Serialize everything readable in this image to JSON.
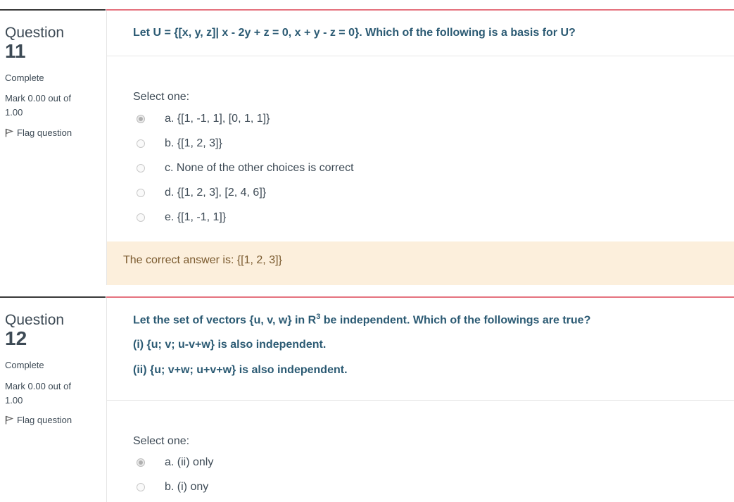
{
  "questions": [
    {
      "label": "Question",
      "number": "11",
      "state": "Complete",
      "mark_line1": "Mark 0.00 out of",
      "mark_line2": "1.00",
      "flag_label": "Flag question",
      "text": "Let U = {[x, y, z]| x - 2y + z = 0, x + y - z = 0}. Which of the following is a basis for U?",
      "prompt": "Select one:",
      "options": [
        {
          "label": "a. {[1, -1, 1], [0, 1, 1]}",
          "selected": true
        },
        {
          "label": "b. {[1, 2, 3]}",
          "selected": false
        },
        {
          "label": "c. None of the other choices is correct",
          "selected": false
        },
        {
          "label": "d. {[1, 2, 3], [2, 4, 6]}",
          "selected": false
        },
        {
          "label": "e. {[1, -1, 1]}",
          "selected": false
        }
      ],
      "feedback": "The correct answer is: {[1, 2, 3]}"
    },
    {
      "label": "Question",
      "number": "12",
      "state": "Complete",
      "mark_line1": "Mark 0.00 out of",
      "mark_line2": "1.00",
      "flag_label": "Flag question",
      "text_line1_a": "Let the set of vectors {u, v, w} in R",
      "text_line1_sup": "3",
      "text_line1_b": " be independent. Which of the followings are true?",
      "text_line2": "(i) {u; v; u-v+w} is also independent.",
      "text_line3": "(ii) {u; v+w; u+v+w} is also independent.",
      "prompt": "Select one:",
      "options": [
        {
          "label": "a. (ii) only",
          "selected": true
        },
        {
          "label": "b. (i) ony",
          "selected": false
        }
      ]
    }
  ],
  "colors": {
    "accent_rule": "#e5737f",
    "question_text": "#2b5a73",
    "feedback_bg": "#fcefdc"
  },
  "icons": {
    "flag": "flag-icon",
    "radio": "radio-button"
  }
}
